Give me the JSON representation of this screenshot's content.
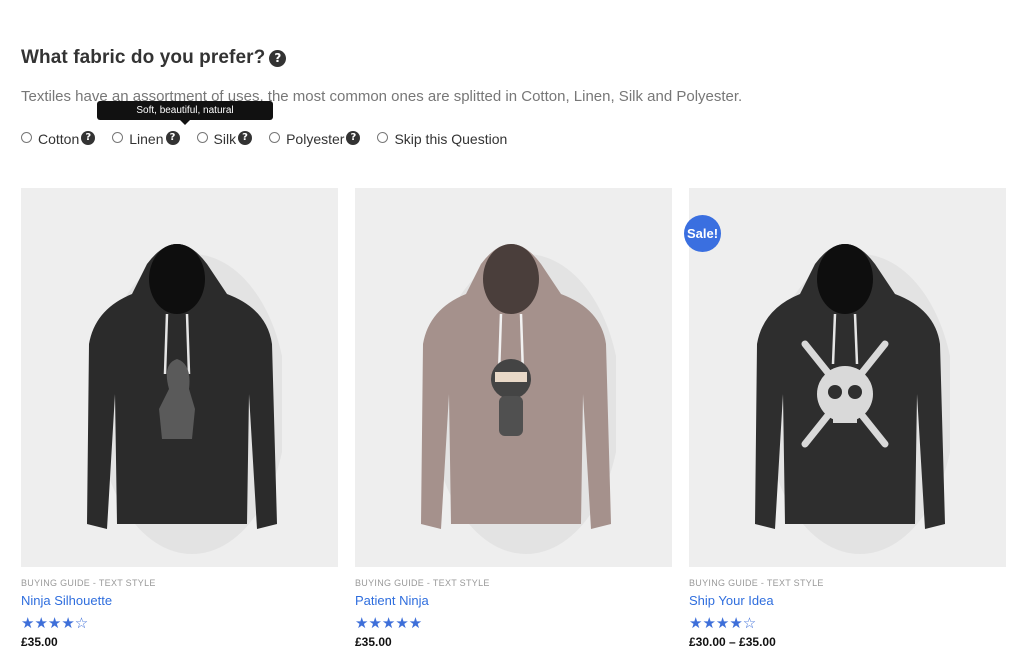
{
  "question": {
    "title": "What fabric do you prefer?",
    "description": "Textiles have an assortment of uses, the most common ones are splitted in Cotton, Linen, Silk and Polyester.",
    "tooltip": "Soft, beautiful, natural"
  },
  "options": [
    {
      "label": "Cotton",
      "help": true
    },
    {
      "label": "Linen",
      "help": true
    },
    {
      "label": "Silk",
      "help": true
    },
    {
      "label": "Polyester",
      "help": true
    },
    {
      "label": "Skip this Question",
      "help": false
    }
  ],
  "products": [
    {
      "category": "BUYING GUIDE - TEXT STYLE",
      "name": "Ninja Silhouette",
      "rating": 4,
      "stars": "★★★★☆",
      "price": "£35.00",
      "sale": "",
      "hoodie_color": "#2b2b2b",
      "print": "silhouette"
    },
    {
      "category": "BUYING GUIDE - TEXT STYLE",
      "name": "Patient Ninja",
      "rating": 5,
      "stars": "★★★★★",
      "price": "£35.00",
      "sale": "",
      "hoodie_color": "#a5918c",
      "print": "ninja"
    },
    {
      "category": "BUYING GUIDE - TEXT STYLE",
      "name": "Ship Your Idea",
      "rating": 4,
      "stars": "★★★★☆",
      "price": "£30.00 – £35.00",
      "sale": "Sale!",
      "hoodie_color": "#2e2e2e",
      "print": "skull"
    }
  ],
  "colors": {
    "link": "#2f6ede",
    "sale_badge": "#3a6fe0",
    "star": "#3e6fd9"
  }
}
